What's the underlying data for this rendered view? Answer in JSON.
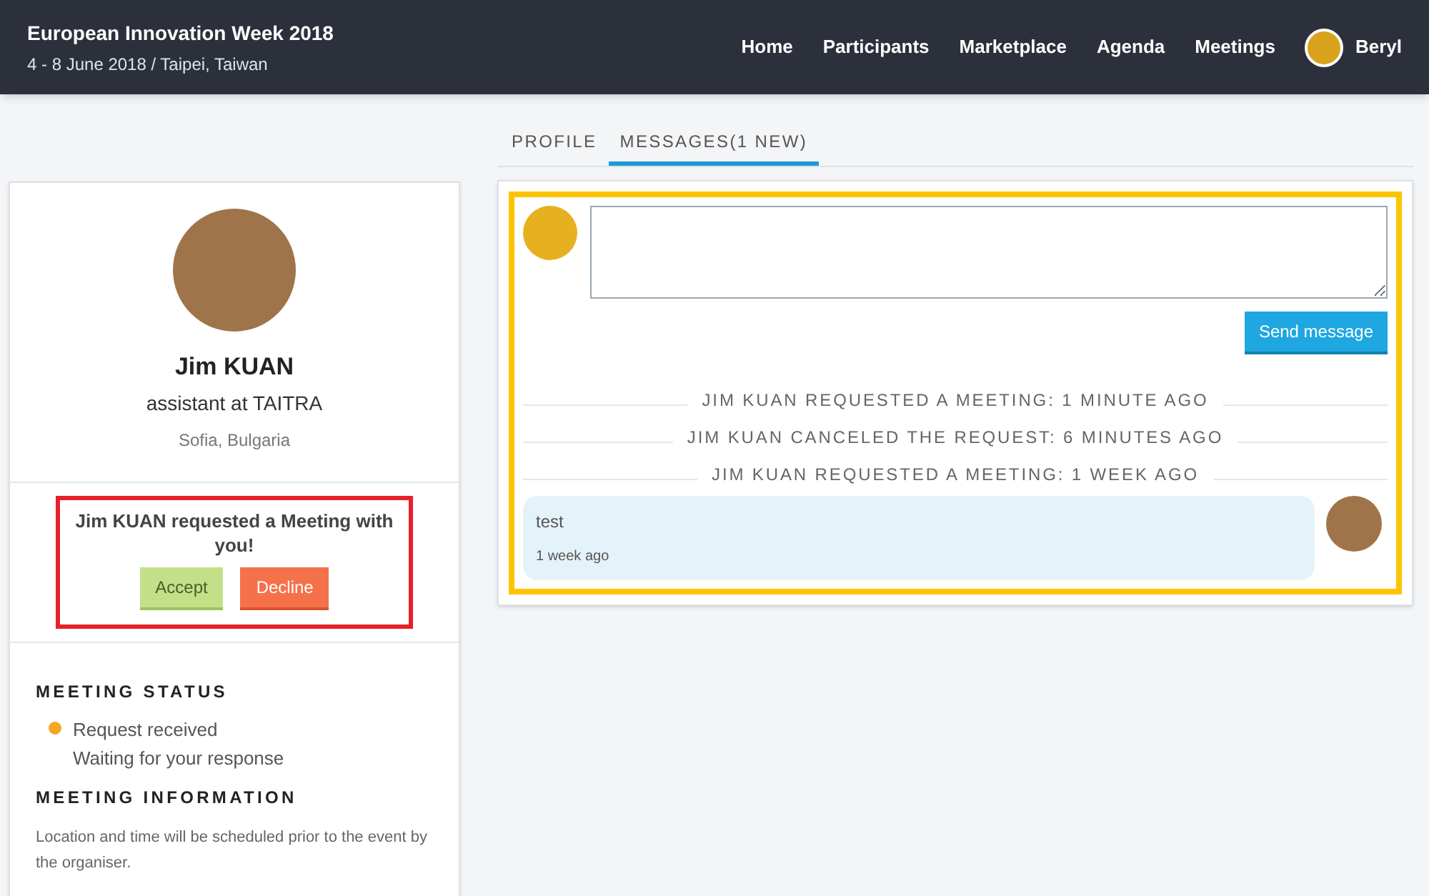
{
  "header": {
    "title": "European Innovation Week 2018",
    "subtitle": "4 - 8 June 2018 / Taipei, Taiwan",
    "nav": [
      "Home",
      "Participants",
      "Marketplace",
      "Agenda",
      "Meetings"
    ],
    "user": "Beryl"
  },
  "profile": {
    "name": "Jim KUAN",
    "role": "assistant at TAITRA",
    "location": "Sofia, Bulgaria"
  },
  "request": {
    "text": "Jim KUAN requested a Meeting with you!",
    "buttons": [
      {
        "label": "Accept",
        "kind": "accept"
      },
      {
        "label": "Decline",
        "kind": "decline"
      }
    ]
  },
  "status": {
    "heading": "MEETING STATUS",
    "state": "Request received",
    "color": "#f5a623",
    "detail": "Waiting for your response"
  },
  "info": {
    "heading": "MEETING INFORMATION",
    "text": "Location and time will be scheduled prior to the event by the organiser."
  },
  "tabs": [
    {
      "label": "PROFILE",
      "selected": false
    },
    {
      "label": "MESSAGES(1 NEW)",
      "selected": true
    }
  ],
  "composer": {
    "button": "Send message"
  },
  "events": [
    "JIM KUAN REQUESTED A MEETING: 1 MINUTE AGO",
    "JIM KUAN CANCELED THE REQUEST: 6 MINUTES AGO",
    "JIM KUAN REQUESTED A MEETING: 1 WEEK AGO"
  ],
  "messages": [
    {
      "text": "test",
      "time": "1 week ago"
    }
  ]
}
